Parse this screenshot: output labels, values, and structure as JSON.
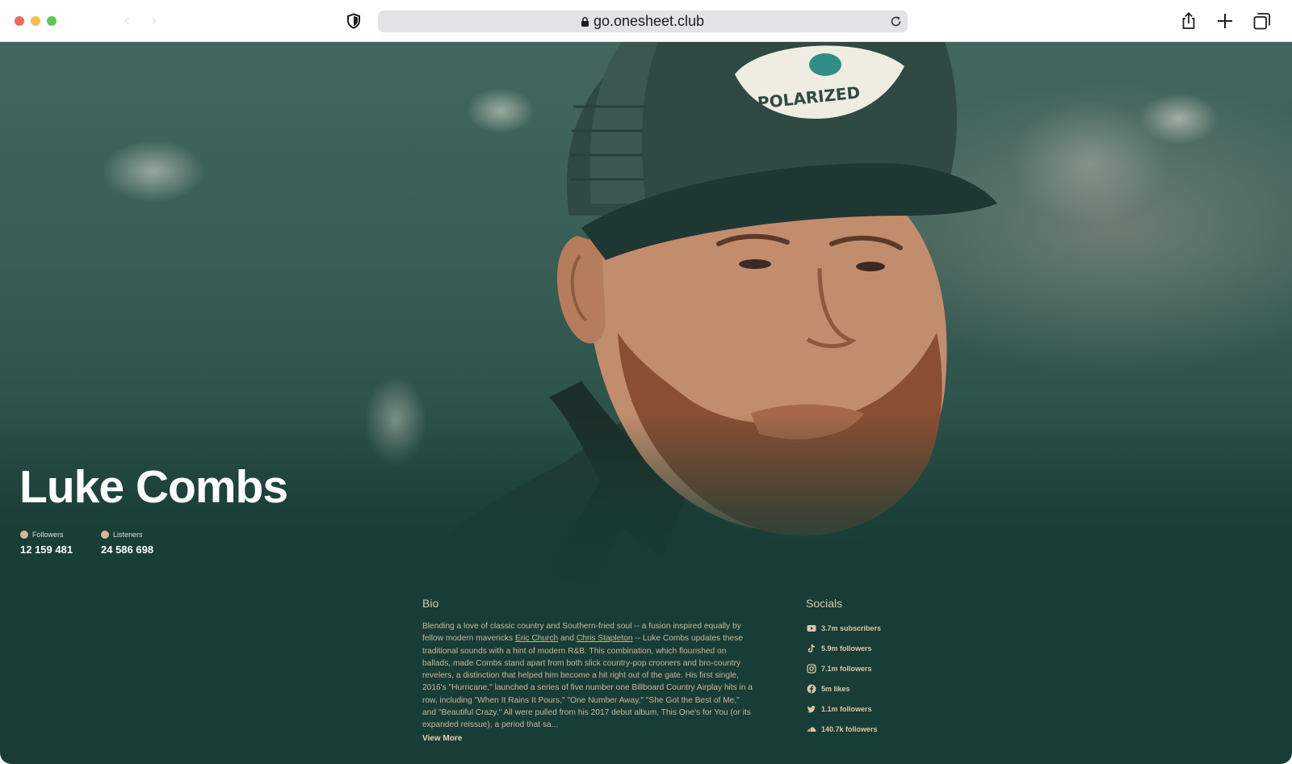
{
  "browser": {
    "url": "go.onesheet.club",
    "icons": [
      "back-icon",
      "forward-icon",
      "shield-icon",
      "lock-icon",
      "reload-icon",
      "share-icon",
      "new-tab-icon",
      "tab-overview-icon"
    ]
  },
  "artist": {
    "name": "Luke Combs"
  },
  "stats": [
    {
      "label": "Followers",
      "value": "12 159 481"
    },
    {
      "label": "Listeners",
      "value": "24 586 698"
    }
  ],
  "bio": {
    "title": "Bio",
    "text_1": "Blending a love of classic country and Southern-fried soul -- a fusion inspired equally by fellow modern mavericks ",
    "link_1": "Eric Church",
    "text_2": " and ",
    "link_2": "Chris Stapleton",
    "text_3": " -- Luke Combs updates these traditional sounds with a hint of modern R&B. This combination, which flourished on ballads, made Combs stand apart from both slick country-pop crooners and bro-country revelers, a distinction that helped him become a hit right out of the gate. His first single, 2016's \"Hurricane,\" launched a series of five number one Billboard Country Airplay hits in a row, including \"When It Rains It Pours,\" \"One Number Away,\" \"She Got the Best of Me,\" and \"Beautiful Crazy.\" All were pulled from his 2017 debut album, This One's for You (or its expanded reissue), a period that sa...",
    "view_more": "View More"
  },
  "socials": {
    "title": "Socials",
    "items": [
      {
        "icon": "youtube-icon",
        "label": "3.7m subscribers"
      },
      {
        "icon": "tiktok-icon",
        "label": "5.9m followers"
      },
      {
        "icon": "instagram-icon",
        "label": "7.1m followers"
      },
      {
        "icon": "facebook-icon",
        "label": "5m likes"
      },
      {
        "icon": "twitter-icon",
        "label": "1.1m followers"
      },
      {
        "icon": "soundcloud-icon",
        "label": "140.7k followers"
      }
    ]
  },
  "colors": {
    "page_background": "#173d36",
    "accent_gold": "#dcc6a6",
    "text_white": "#ffffff"
  }
}
